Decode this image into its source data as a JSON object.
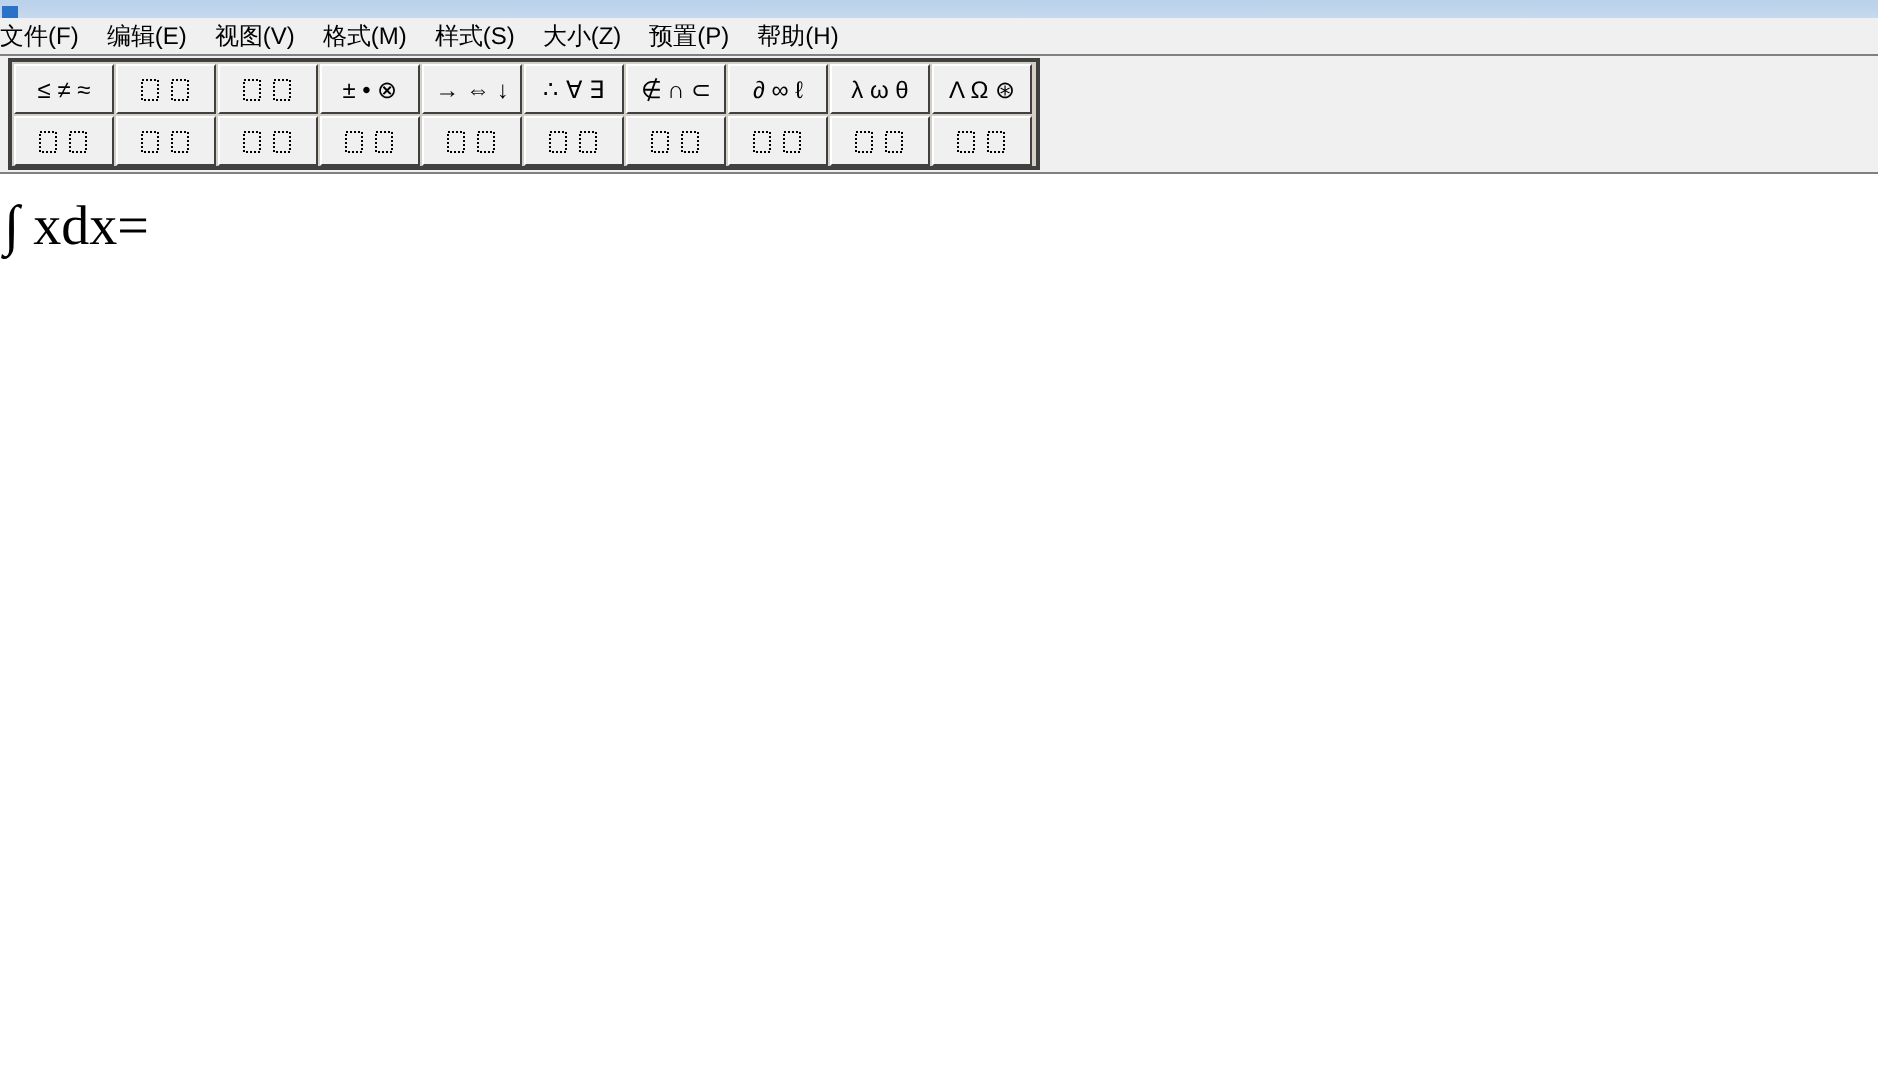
{
  "menu": [
    "文件(F)",
    "编辑(E)",
    "视图(V)",
    "格式(M)",
    "样式(S)",
    "大小(Z)",
    "预置(P)",
    "帮助(H)"
  ],
  "toolbar": {
    "rows": [
      [
        {
          "kind": "symbols",
          "label": "≤ ≠ ≈"
        },
        {
          "kind": "template"
        },
        {
          "kind": "template"
        },
        {
          "kind": "symbols",
          "label": "± • ⊗"
        },
        {
          "kind": "symbols",
          "label": "→ ⇔ ↓"
        },
        {
          "kind": "symbols",
          "label": "∴ ∀ ∃"
        },
        {
          "kind": "symbols",
          "label": "∉ ∩ ⊂"
        },
        {
          "kind": "symbols",
          "label": "∂ ∞ ℓ"
        },
        {
          "kind": "symbols",
          "label": "λ ω θ"
        },
        {
          "kind": "symbols",
          "label": "Λ Ω ⊛"
        }
      ],
      [
        {
          "kind": "template"
        },
        {
          "kind": "template"
        },
        {
          "kind": "template"
        },
        {
          "kind": "template"
        },
        {
          "kind": "template"
        },
        {
          "kind": "template"
        },
        {
          "kind": "template"
        },
        {
          "kind": "template"
        },
        {
          "kind": "template"
        },
        {
          "kind": "template"
        }
      ]
    ]
  },
  "equation": "∫ xdx="
}
